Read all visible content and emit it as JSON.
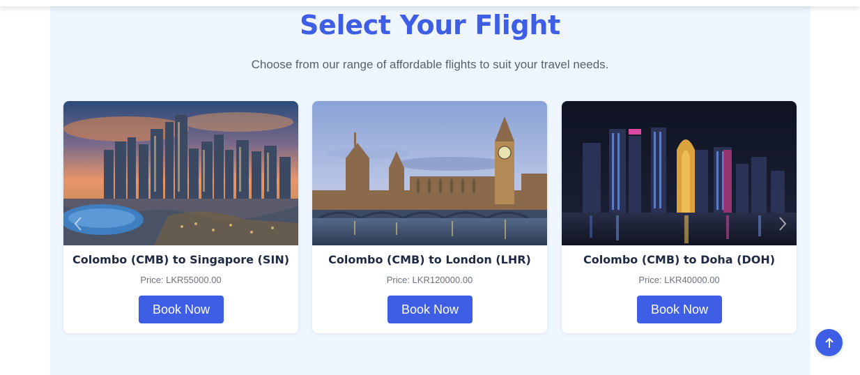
{
  "section": {
    "title": "Select Your Flight",
    "subtitle": "Choose from our range of affordable flights to suit your travel needs."
  },
  "flights": [
    {
      "route": "Colombo (CMB) to Singapore (SIN)",
      "price": "Price: LKR55000.00",
      "button": "Book Now",
      "image": "singapore-skyline-image"
    },
    {
      "route": "Colombo (CMB) to London (LHR)",
      "price": "Price: LKR120000.00",
      "button": "Book Now",
      "image": "london-parliament-image"
    },
    {
      "route": "Colombo (CMB) to Doha (DOH)",
      "price": "Price: LKR40000.00",
      "button": "Book Now",
      "image": "doha-skyline-image"
    }
  ],
  "carousel": {
    "prev_icon": "chevron-left-icon",
    "next_icon": "chevron-right-icon"
  },
  "scroll_top": {
    "icon": "arrow-up-icon"
  },
  "colors": {
    "accent": "#3f5ee6",
    "section_bg": "#eff6ff",
    "title_text": "#1e2a44",
    "muted_text": "#6b7280"
  }
}
